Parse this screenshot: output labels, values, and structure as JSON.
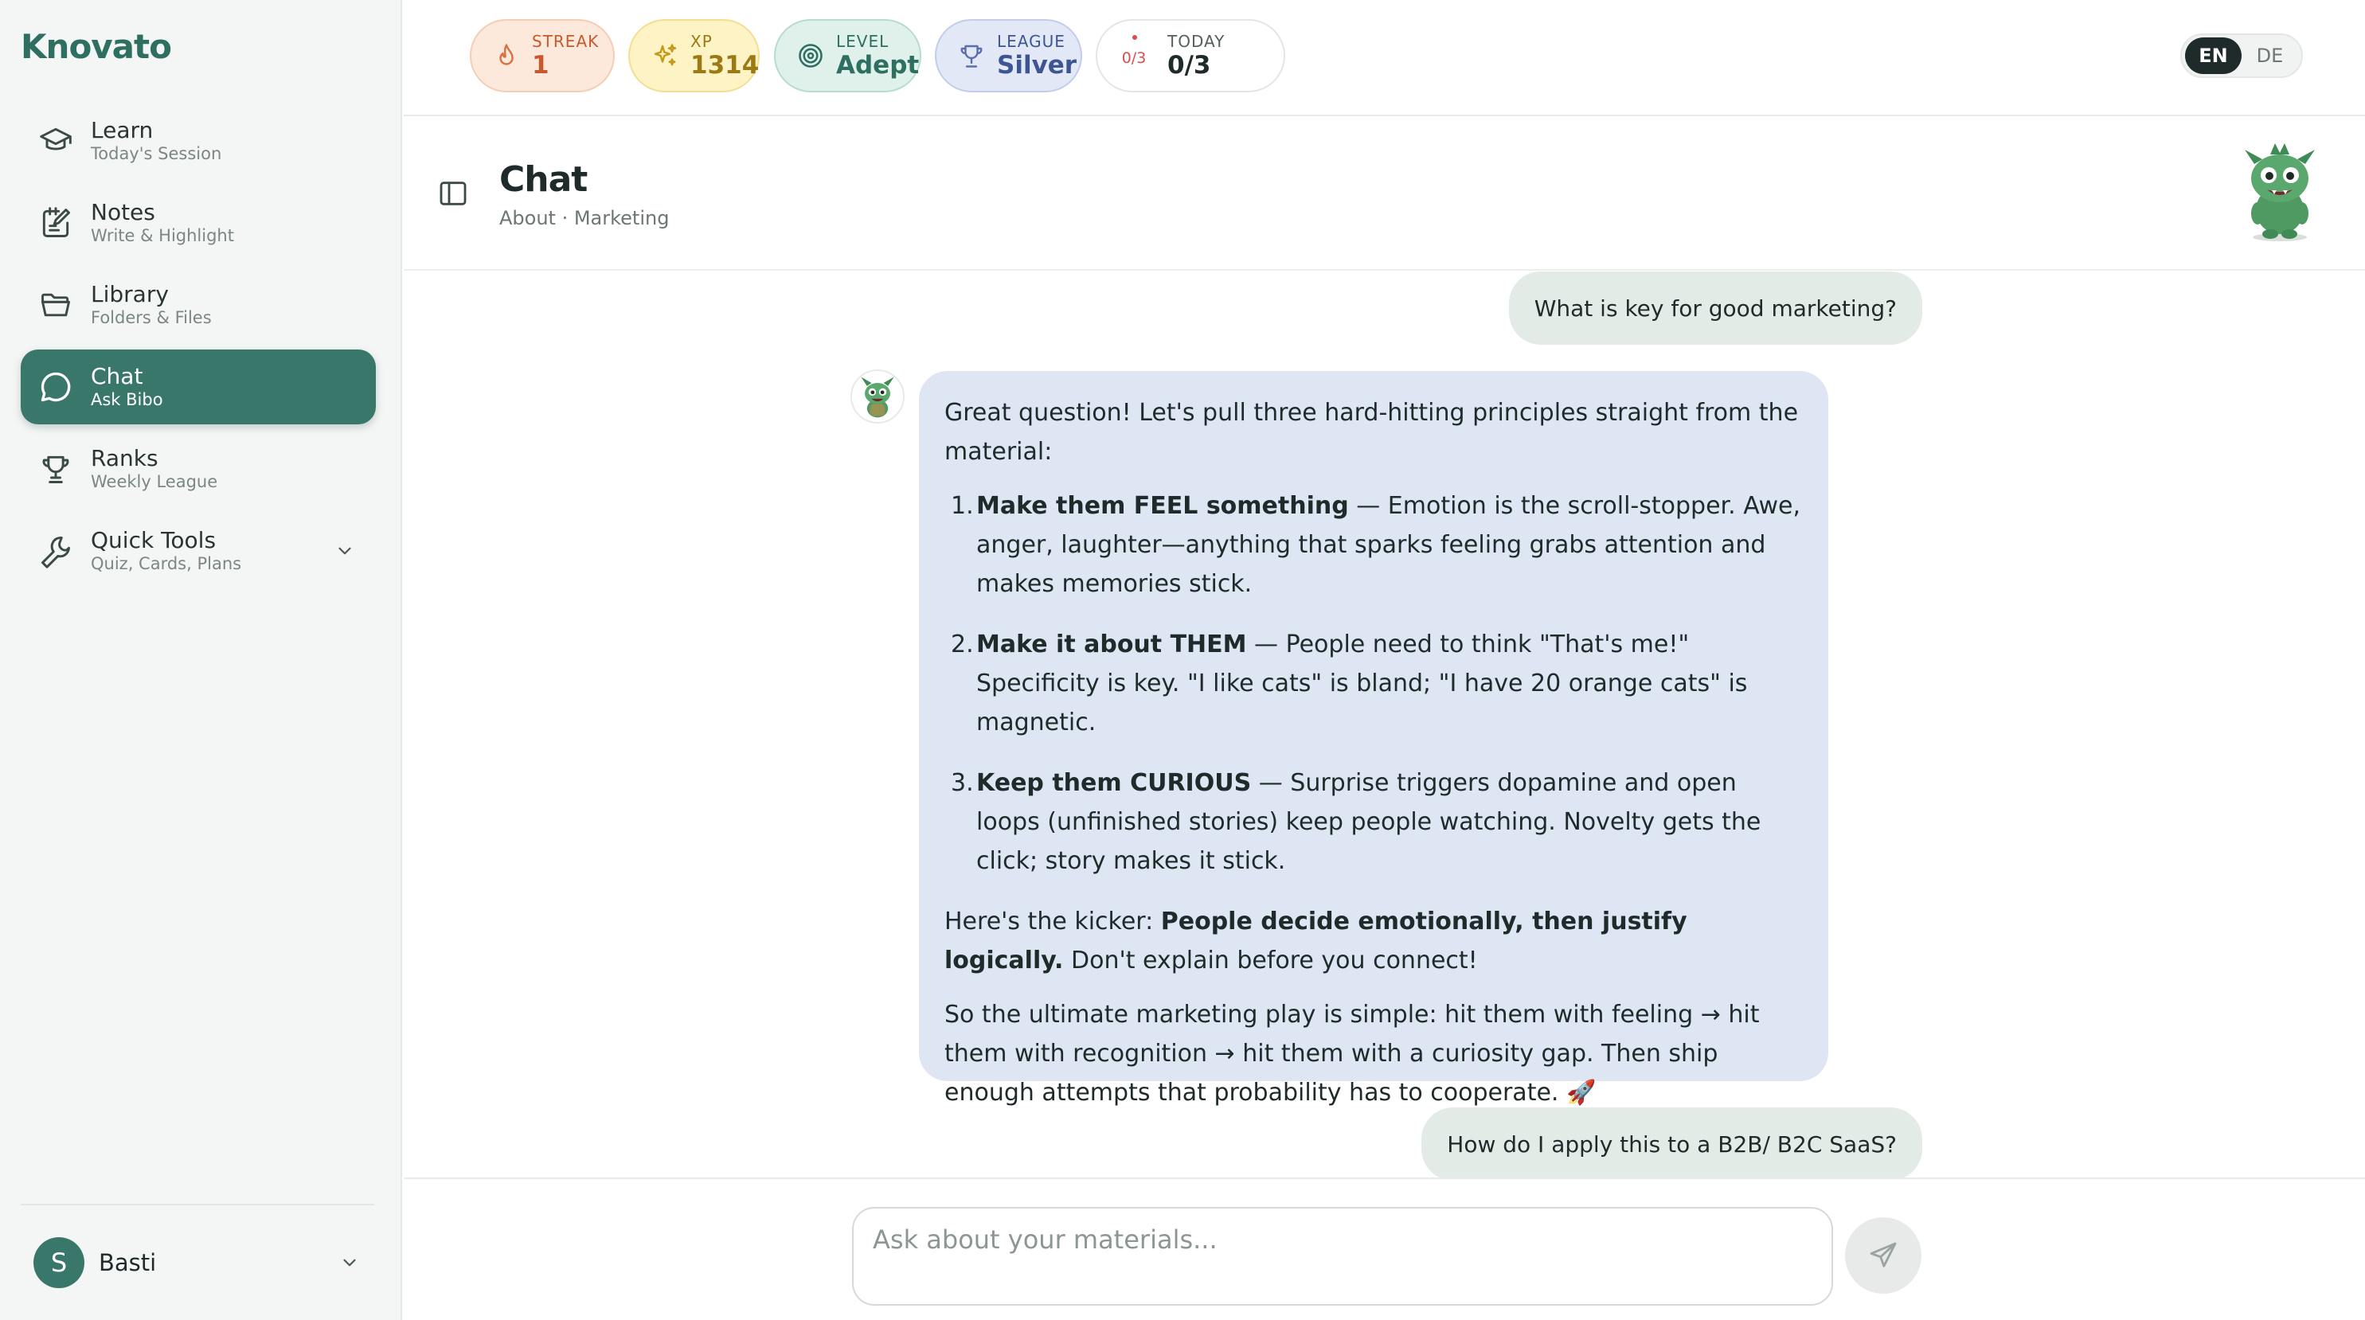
{
  "app": {
    "name": "Knovato"
  },
  "sidebar": {
    "items": [
      {
        "label": "Learn",
        "sub": "Today's Session",
        "icon": "graduation-cap-icon"
      },
      {
        "label": "Notes",
        "sub": "Write & Highlight",
        "icon": "notes-icon"
      },
      {
        "label": "Library",
        "sub": "Folders & Files",
        "icon": "folder-icon"
      },
      {
        "label": "Chat",
        "sub": "Ask Bibo",
        "icon": "chat-bubble-icon",
        "active": true
      },
      {
        "label": "Ranks",
        "sub": "Weekly League",
        "icon": "trophy-icon"
      },
      {
        "label": "Quick Tools",
        "sub": "Quiz, Cards, Plans",
        "icon": "wrench-icon",
        "expandable": true
      }
    ],
    "user": {
      "initial": "S",
      "name": "Basti"
    }
  },
  "stats": {
    "streak": {
      "label": "STREAK",
      "value": "1"
    },
    "xp": {
      "label": "XP",
      "value": "1314"
    },
    "level": {
      "label": "LEVEL",
      "value": "Adept"
    },
    "league": {
      "label": "LEAGUE",
      "value": "Silver"
    },
    "today": {
      "label": "TODAY",
      "value": "0/3",
      "ring": "0/3",
      "progress": 0
    }
  },
  "language": {
    "options": [
      "EN",
      "DE"
    ],
    "selected": "EN"
  },
  "chat": {
    "title": "Chat",
    "subtitle": "About · Marketing",
    "messages": {
      "user1": "What is key for good marketing?",
      "bot": {
        "intro": "Great question! Let's pull three hard-hitting principles straight from the material:",
        "points": [
          {
            "num": "1.",
            "title": "Make them FEEL something",
            "text": " — Emotion is the scroll-stopper. Awe, anger, laughter—anything that sparks feeling grabs attention and makes memories stick."
          },
          {
            "num": "2.",
            "title": "Make it about THEM",
            "text": " — People need to think \"That's me!\" Specificity is key. \"I like cats\" is bland; \"I have 20 orange cats\" is magnetic."
          },
          {
            "num": "3.",
            "title": "Keep them CURIOUS",
            "text": " — Surprise triggers dopamine and open loops (unfinished stories) keep people watching. Novelty gets the click; story makes it stick."
          }
        ],
        "kicker_pre": "Here's the kicker: ",
        "kicker_bold": "People decide emotionally, then justify logically.",
        "kicker_post": " Don't explain before you connect!",
        "closing": "So the ultimate marketing play is simple: hit them with feeling → hit them with recognition → hit them with a curiosity gap. Then ship enough attempts that probability has to cooperate. 🚀"
      },
      "user2": "How do I apply this to a B2B/ B2C SaaS?"
    },
    "input": {
      "placeholder": "Ask about your materials..."
    }
  },
  "colors": {
    "brand": "#3a776b",
    "bot_bubble": "#dee5f3",
    "user_bubble": "#e3ebe7"
  }
}
